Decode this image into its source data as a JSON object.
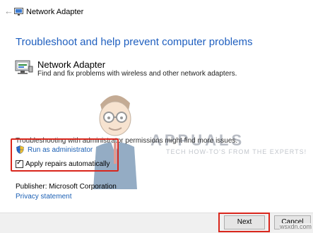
{
  "window": {
    "title": "Network Adapter",
    "back_icon": "arrow-left-icon"
  },
  "heading": "Troubleshoot and help prevent computer problems",
  "troubleshooter": {
    "name": "Network Adapter",
    "description": "Find and fix problems with wireless and other network adapters."
  },
  "watermark": {
    "brand": "APPUALS",
    "tagline": "TECH HOW-TO'S FROM THE EXPERTS!"
  },
  "permissions_text": "Troubleshooting with administrator permissions might find more issues.",
  "run_as_admin": "Run as administrator",
  "apply_repairs": {
    "label": "Apply repairs automatically",
    "checked": true
  },
  "publisher": "Publisher:  Microsoft Corporation",
  "privacy_link": "Privacy statement",
  "buttons": {
    "next": "Next",
    "cancel": "Cancel"
  },
  "corner_watermark": "wsxdn.com",
  "colors": {
    "accent_blue": "#1f5fbf",
    "link_blue": "#1a5fb4",
    "highlight_red": "#d9261c"
  }
}
